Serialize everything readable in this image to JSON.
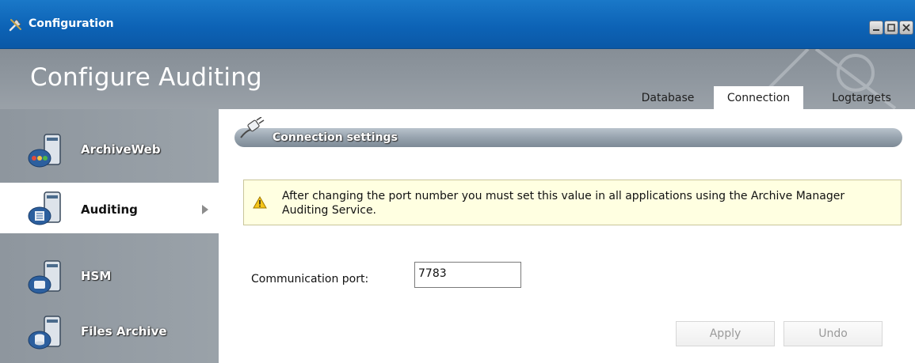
{
  "window": {
    "title": "Configuration",
    "icon": "tools-icon"
  },
  "header": {
    "page_title": "Configure Auditing",
    "tabs": [
      {
        "label": "Database",
        "selected": false
      },
      {
        "label": "Connection",
        "selected": true
      },
      {
        "label": "Logtargets",
        "selected": false
      }
    ]
  },
  "sidebar": {
    "items": [
      {
        "label": "ArchiveWeb",
        "icon": "archiveweb-server-icon",
        "selected": false
      },
      {
        "label": "Auditing",
        "icon": "auditing-server-icon",
        "selected": true
      },
      {
        "label": "HSM",
        "icon": "hsm-server-icon",
        "selected": false
      },
      {
        "label": "Files Archive",
        "icon": "files-archive-server-icon",
        "selected": false
      }
    ]
  },
  "section": {
    "title": "Connection settings",
    "icon": "plug-icon"
  },
  "warning": {
    "icon": "warning-icon",
    "text": "After changing the port number you must set this value in all applications using the Archive Manager Auditing Service."
  },
  "form": {
    "port_label": "Communication port:",
    "port_value": "7783"
  },
  "buttons": {
    "apply": "Apply",
    "undo": "Undo"
  },
  "colors": {
    "titlebar": "#0d63b6",
    "header": "#8f979f",
    "warning_bg": "#ffffe1"
  }
}
